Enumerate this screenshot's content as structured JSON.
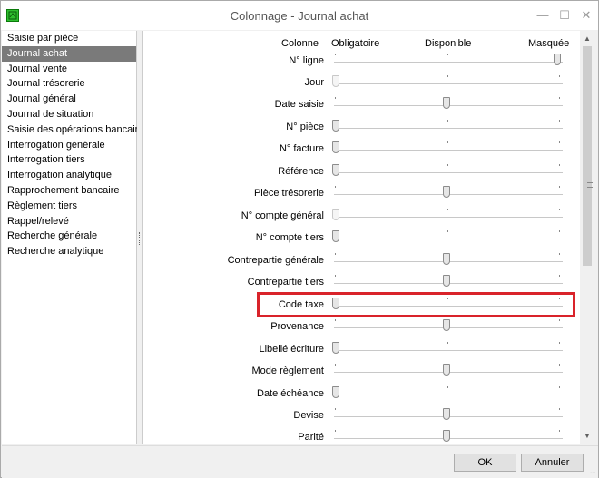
{
  "window": {
    "title": "Colonnage - Journal achat",
    "minimize_icon": "minimize-icon",
    "maximize_icon": "maximize-icon",
    "close_icon": "close-icon"
  },
  "sidebar": {
    "items": [
      {
        "label": "Saisie par pièce",
        "selected": false
      },
      {
        "label": "Journal achat",
        "selected": true
      },
      {
        "label": "Journal vente",
        "selected": false
      },
      {
        "label": "Journal trésorerie",
        "selected": false
      },
      {
        "label": "Journal général",
        "selected": false
      },
      {
        "label": "Journal de situation",
        "selected": false
      },
      {
        "label": "Saisie des opérations bancaires",
        "selected": false
      },
      {
        "label": "Interrogation générale",
        "selected": false
      },
      {
        "label": "Interrogation tiers",
        "selected": false
      },
      {
        "label": "Interrogation analytique",
        "selected": false
      },
      {
        "label": "Rapprochement bancaire",
        "selected": false
      },
      {
        "label": "Règlement tiers",
        "selected": false
      },
      {
        "label": "Rappel/relevé",
        "selected": false
      },
      {
        "label": "Recherche générale",
        "selected": false
      },
      {
        "label": "Recherche analytique",
        "selected": false
      }
    ]
  },
  "columns_header": {
    "colonne": "Colonne",
    "obligatoire": "Obligatoire",
    "disponible": "Disponible",
    "masquee": "Masquée"
  },
  "rows": [
    {
      "label": "N° ligne",
      "level": "Masquée",
      "enabled": true
    },
    {
      "label": "Jour",
      "level": "Obligatoire",
      "enabled": false
    },
    {
      "label": "Date saisie",
      "level": "Disponible",
      "enabled": true
    },
    {
      "label": "N° pièce",
      "level": "Obligatoire",
      "enabled": true
    },
    {
      "label": "N° facture",
      "level": "Obligatoire",
      "enabled": true
    },
    {
      "label": "Référence",
      "level": "Obligatoire",
      "enabled": true
    },
    {
      "label": "Pièce trésorerie",
      "level": "Disponible",
      "enabled": true
    },
    {
      "label": "N° compte général",
      "level": "Obligatoire",
      "enabled": false
    },
    {
      "label": "N° compte tiers",
      "level": "Obligatoire",
      "enabled": true
    },
    {
      "label": "Contrepartie générale",
      "level": "Disponible",
      "enabled": true
    },
    {
      "label": "Contrepartie tiers",
      "level": "Disponible",
      "enabled": true
    },
    {
      "label": "Code taxe",
      "level": "Obligatoire",
      "enabled": true
    },
    {
      "label": "Provenance",
      "level": "Disponible",
      "enabled": true
    },
    {
      "label": "Libellé écriture",
      "level": "Obligatoire",
      "enabled": true
    },
    {
      "label": "Mode règlement",
      "level": "Disponible",
      "enabled": true
    },
    {
      "label": "Date échéance",
      "level": "Obligatoire",
      "enabled": true
    },
    {
      "label": "Devise",
      "level": "Disponible",
      "enabled": true
    },
    {
      "label": "Parité",
      "level": "Disponible",
      "enabled": true
    }
  ],
  "highlighted_row": "Code taxe",
  "highlight_color": "#d9232a",
  "footer": {
    "ok_label": "OK",
    "cancel_label": "Annuler"
  }
}
